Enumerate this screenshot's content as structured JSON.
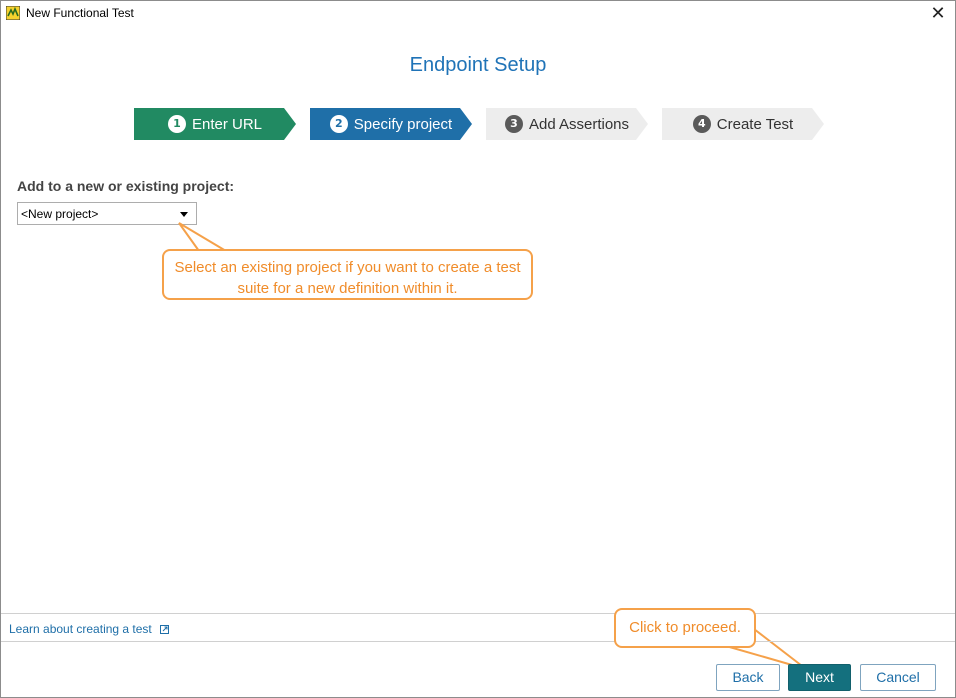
{
  "window": {
    "title": "New Functional Test",
    "close_glyph": "✕"
  },
  "heading": "Endpoint Setup",
  "steps": [
    {
      "num": "1",
      "label": "Enter URL",
      "state": "done"
    },
    {
      "num": "2",
      "label": "Specify project",
      "state": "active"
    },
    {
      "num": "3",
      "label": "Add Assertions",
      "state": "todo"
    },
    {
      "num": "4",
      "label": "Create Test",
      "state": "todo"
    }
  ],
  "project": {
    "label": "Add to a new or existing project:",
    "selected": "<New project>"
  },
  "callouts": {
    "project_hint": "Select an existing project if you want to create a test suite for a new definition within it.",
    "next_hint": "Click to proceed."
  },
  "footer": {
    "learn_link": "Learn about creating a test"
  },
  "buttons": {
    "back": "Back",
    "next": "Next",
    "cancel": "Cancel"
  },
  "colors": {
    "heading": "#1f73b7",
    "step_done": "#218a62",
    "step_active": "#1f6fa8",
    "step_todo": "#ededed",
    "callout": "#f5a14a",
    "next_button": "#14707e"
  }
}
